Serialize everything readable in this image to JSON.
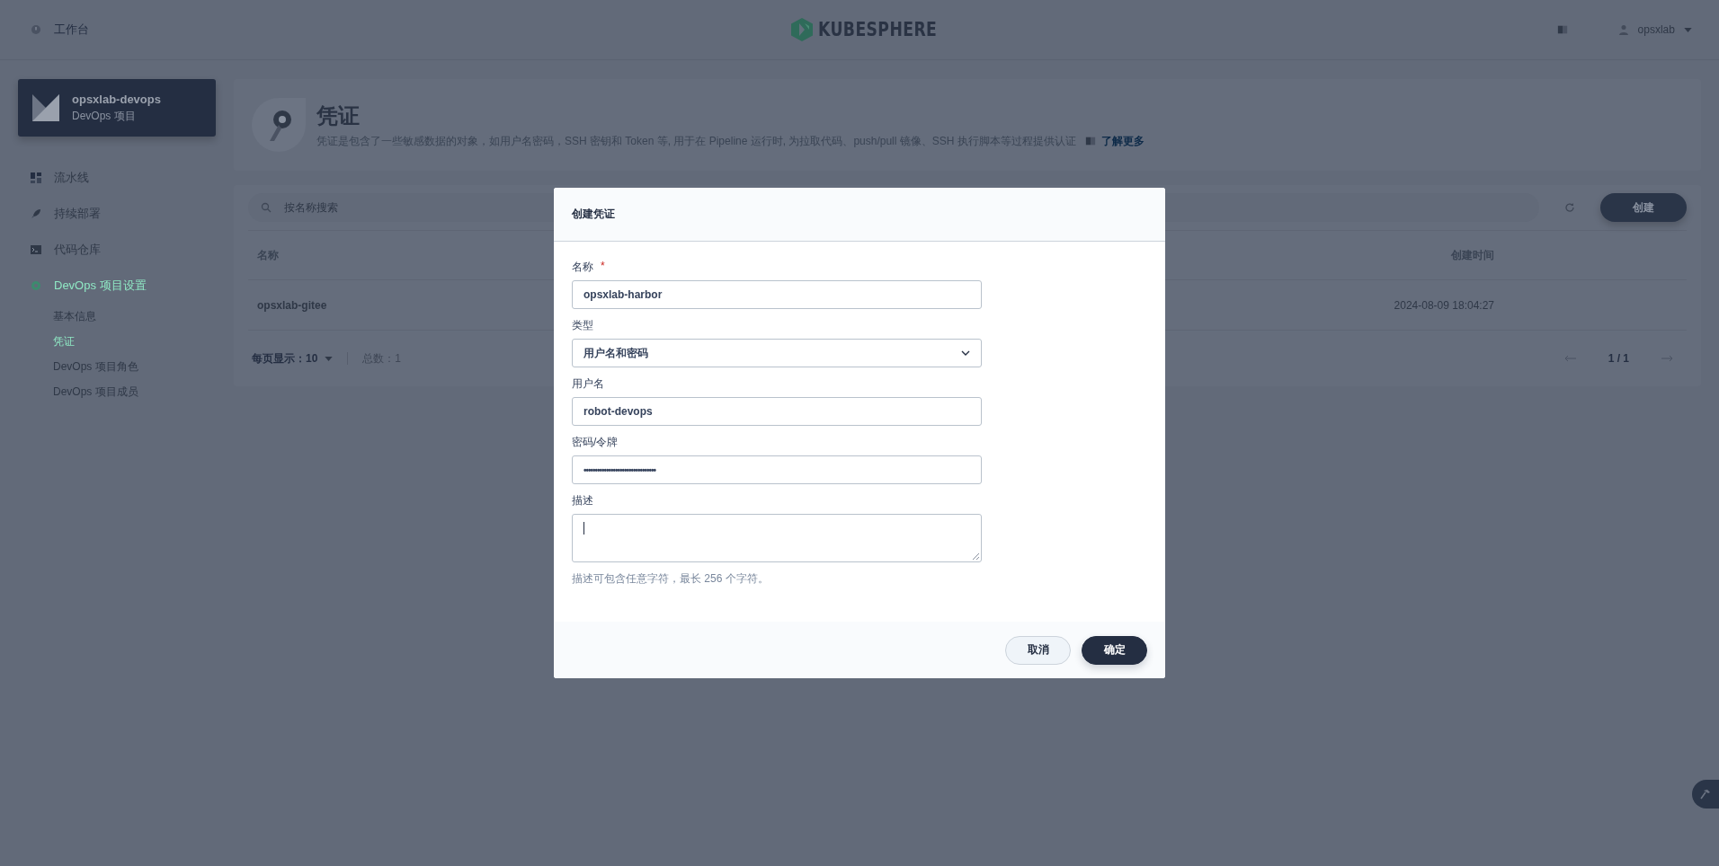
{
  "topbar": {
    "workbench": "工作台",
    "logo_text": "KUBESPHERE",
    "user": "opsxlab"
  },
  "sidebar": {
    "project": {
      "name": "opsxlab-devops",
      "subtitle": "DevOps 项目"
    },
    "items": [
      {
        "kind": "pipeline",
        "label": "流水线",
        "selected": false
      },
      {
        "kind": "deploy",
        "label": "持续部署",
        "selected": false
      },
      {
        "kind": "code",
        "label": "代码仓库",
        "selected": false
      },
      {
        "kind": "settings",
        "label": "DevOps 项目设置",
        "selected": true,
        "expanded": true,
        "children": [
          {
            "label": "基本信息",
            "selected": false
          },
          {
            "label": "凭证",
            "selected": true
          },
          {
            "label": "DevOps 项目角色",
            "selected": false
          },
          {
            "label": "DevOps 项目成员",
            "selected": false
          }
        ]
      }
    ]
  },
  "page_header": {
    "title": "凭证",
    "description": "凭证是包含了一些敏感数据的对象，如用户名密码，SSH 密钥和 Token 等, 用于在 Pipeline 运行时, 为拉取代码、push/pull 镜像、SSH 执行脚本等过程提供认证",
    "link": "了解更多"
  },
  "table": {
    "search": {
      "placeholder": "按名称搜索"
    },
    "create_button": "创建",
    "columns": [
      "名称",
      "创建时间"
    ],
    "rows": [
      {
        "cells": [
          "opsxlab-gitee",
          "2024-08-09 18:04:27"
        ]
      }
    ],
    "pagination": {
      "per_page_label": "每页显示：",
      "per_page": "10",
      "total": "总数：1",
      "page": "1 / 1"
    }
  },
  "dialog": {
    "title": "创建凭证",
    "fields": [
      {
        "kind": "text",
        "label": "名称",
        "required_mark": "*",
        "value": "opsxlab-harbor"
      },
      {
        "kind": "select",
        "label": "类型",
        "value": "用户名和密码"
      },
      {
        "kind": "text",
        "label": "用户名",
        "value": "robot-devops"
      },
      {
        "kind": "password",
        "label": "密码/令牌",
        "value": "••••••••••••••••••••••••••••••••"
      },
      {
        "kind": "textarea",
        "label": "描述",
        "focused": true
      }
    ],
    "hint": "描述可包含任意字符，最长 256 个字符。",
    "buttons": [
      {
        "label": "取消",
        "primary": false
      },
      {
        "label": "确定",
        "primary": true
      }
    ]
  }
}
